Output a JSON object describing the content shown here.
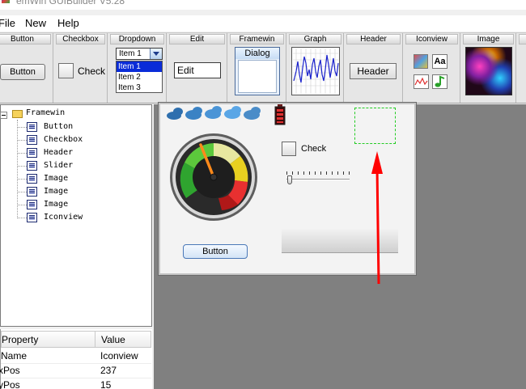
{
  "window": {
    "title": "emWin GUIBuilder V5.28"
  },
  "menu": {
    "items": [
      "File",
      "New",
      "Help"
    ]
  },
  "toolbar": {
    "tools": [
      "Button",
      "Checkbox",
      "Dropdown",
      "Edit",
      "Framewin",
      "Graph",
      "Header",
      "Iconview",
      "Image"
    ],
    "button_widget_label": "Button",
    "checkbox_widget_label": "Check",
    "dropdown_selected": "Item 1",
    "dropdown_options": [
      "Item 1",
      "Item 2",
      "Item 3"
    ],
    "edit_widget_value": "Edit",
    "framewin_widget_title": "Dialog",
    "header_widget_label": "Header",
    "iconview_text_icon": "Aa"
  },
  "tree": {
    "root": "Framewin",
    "children": [
      "Button",
      "Checkbox",
      "Header",
      "Slider",
      "Image",
      "Image",
      "Image",
      "Iconview"
    ]
  },
  "properties": {
    "headers": {
      "property": "Property",
      "value": "Value"
    },
    "rows": [
      {
        "name": "Name",
        "value": "Iconview"
      },
      {
        "name": "xPos",
        "value": "237"
      },
      {
        "name": "yPos",
        "value": "15"
      }
    ]
  },
  "canvas": {
    "checkbox_label": "Check",
    "button_label": "Button",
    "accent_color": "#ff0000",
    "selection_color": "#22cc22"
  }
}
